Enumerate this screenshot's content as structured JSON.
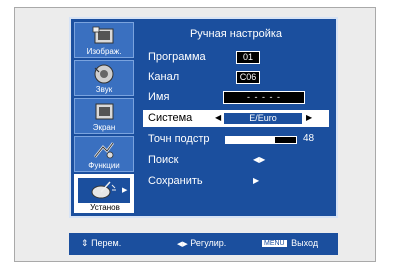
{
  "osd": {
    "title": "Ручная настройка",
    "sidebar": [
      {
        "label": "Изображ.",
        "icon": "picture-icon"
      },
      {
        "label": "Звук",
        "icon": "sound-icon"
      },
      {
        "label": "Экран",
        "icon": "screen-icon"
      },
      {
        "label": "Функции",
        "icon": "functions-icon"
      },
      {
        "label": "Установ",
        "icon": "setup-icon",
        "active": true
      }
    ],
    "rows": {
      "program": {
        "label": "Программа",
        "value": "01"
      },
      "channel": {
        "label": "Канал",
        "value": "C06"
      },
      "name": {
        "label": "Имя",
        "value": "- - - - -"
      },
      "system": {
        "label": "Система",
        "value": "E/Euro",
        "left_arrow": "◀",
        "right_arrow": "▶"
      },
      "fine": {
        "label": "Точн подстр",
        "value": "48",
        "level_fraction": 0.7
      },
      "search": {
        "label": "Поиск",
        "arrows": "◀▶"
      },
      "save": {
        "label": "Сохранить",
        "arrow": "▶"
      }
    },
    "footer": {
      "move_icon": "⇕",
      "move": "Перем.",
      "adjust_icon": "◀▶",
      "adjust": "Регулир.",
      "menu_key": "MENU",
      "exit": "Выход"
    }
  }
}
